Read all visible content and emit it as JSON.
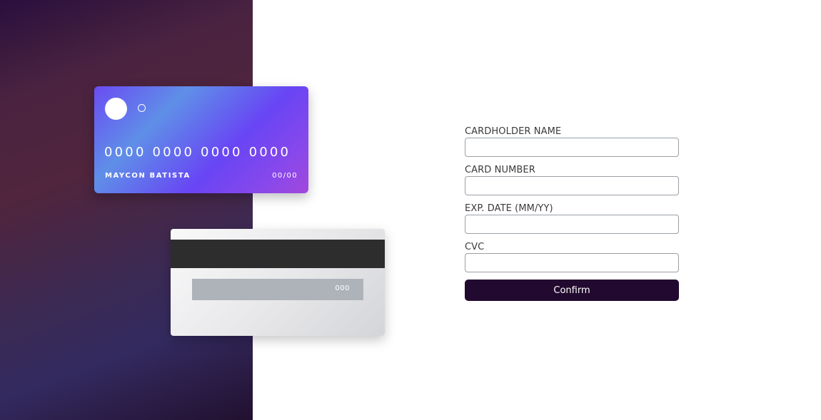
{
  "card_front": {
    "number": "0000 0000 0000 0000",
    "holder_name": "MAYCON BATISTA",
    "expiry": "00/00"
  },
  "card_back": {
    "cvc": "000"
  },
  "form": {
    "fields": [
      {
        "label": "CARDHOLDER NAME",
        "value": ""
      },
      {
        "label": "CARD NUMBER",
        "value": ""
      },
      {
        "label": "EXP. DATE (MM/YY)",
        "value": ""
      },
      {
        "label": "CVC",
        "value": ""
      }
    ],
    "confirm_label": "Confirm"
  },
  "colors": {
    "button": "#21092f",
    "card_front_accent": "#6845f4",
    "panel_dark": "#2a0f3d"
  }
}
